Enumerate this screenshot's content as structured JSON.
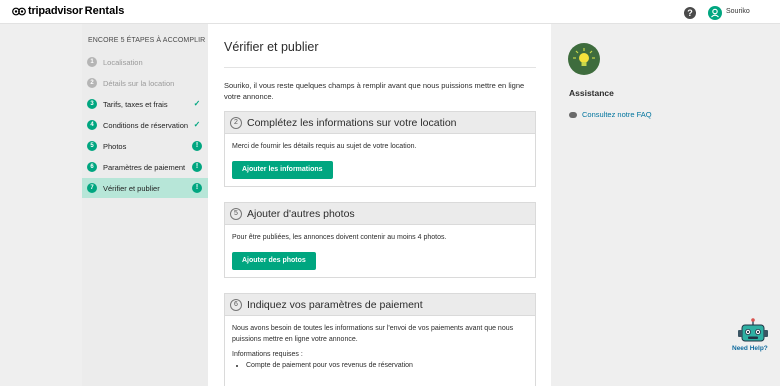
{
  "header": {
    "brand_name": "tripadvisor",
    "brand_suffix": "Rentals",
    "help_glyph": "?",
    "username": "Souriko"
  },
  "sidebar": {
    "heading": "ENCORE 5 ÉTAPES À ACCOMPLIR",
    "steps": [
      {
        "num": "1",
        "label": "Localisation",
        "state": "done-gray",
        "status": ""
      },
      {
        "num": "2",
        "label": "Détails sur la location",
        "state": "done-gray",
        "status": ""
      },
      {
        "num": "3",
        "label": "Tarifs, taxes et frais",
        "state": "complete",
        "status": "✓"
      },
      {
        "num": "4",
        "label": "Conditions de réservation",
        "state": "complete",
        "status": "✓"
      },
      {
        "num": "5",
        "label": "Photos",
        "state": "incomplete",
        "status": "!"
      },
      {
        "num": "6",
        "label": "Paramètres de paiement",
        "state": "incomplete",
        "status": "!"
      },
      {
        "num": "7",
        "label": "Vérifier et publier",
        "state": "current",
        "status": "!"
      }
    ]
  },
  "main": {
    "title": "Vérifier et publier",
    "intro": "Souriko, il vous reste quelques champs à remplir avant que nous puissions mettre en ligne votre annonce.",
    "cards": [
      {
        "num": "2",
        "title": "Complétez les informations sur votre location",
        "text": "Merci de fournir les détails requis au sujet de votre location.",
        "button": "Ajouter les informations"
      },
      {
        "num": "5",
        "title": "Ajouter d'autres photos",
        "text": "Pour être publiées, les annonces doivent contenir au moins 4 photos.",
        "button": "Ajouter des photos"
      },
      {
        "num": "6",
        "title": "Indiquez vos paramètres de paiement",
        "text": "Nous avons besoin de toutes les informations sur l'envoi de vos paiements avant que nous puissions mettre en ligne votre annonce.",
        "required_label": "Informations requises :",
        "required_items": [
          "Compte de paiement pour vos revenus de réservation"
        ]
      }
    ]
  },
  "assistance": {
    "title": "Assistance",
    "faq_link": "Consultez notre FAQ",
    "need_help": "Need Help?"
  },
  "colors": {
    "accent": "#00a680",
    "current_step_bg": "#b7e6d8",
    "link": "#00749e",
    "bulb_bg": "#3e6c3d"
  }
}
